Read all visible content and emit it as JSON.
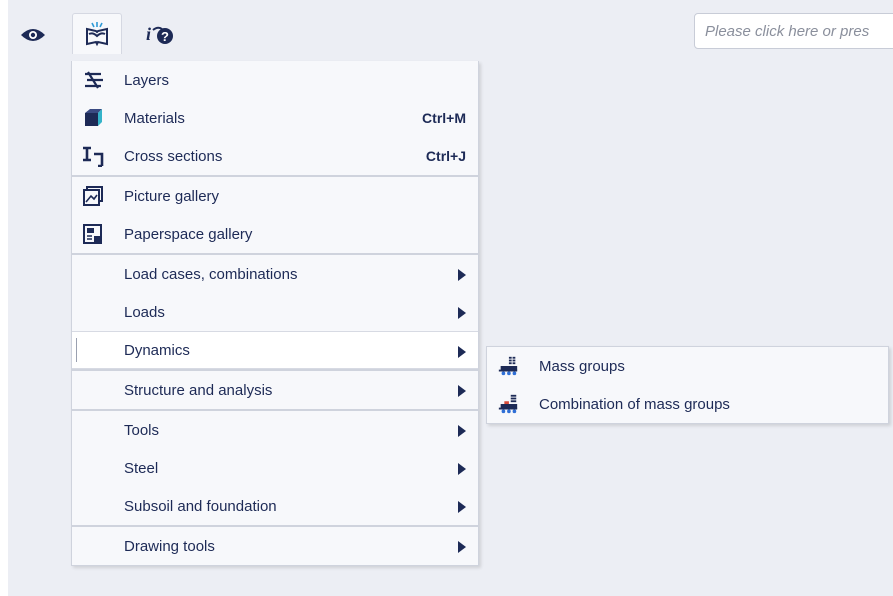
{
  "toolbar": {
    "icons": [
      "eye-icon",
      "library-book-icon",
      "help-search-icon"
    ],
    "search_placeholder": "Please click here or pres"
  },
  "menu": {
    "groups": [
      {
        "items": [
          {
            "label": "Layers",
            "icon": "layers-icon",
            "shortcut": ""
          },
          {
            "label": "Materials",
            "icon": "materials-cube-icon",
            "shortcut": "Ctrl+M"
          },
          {
            "label": "Cross sections",
            "icon": "cross-section-icon",
            "shortcut": "Ctrl+J"
          }
        ]
      },
      {
        "items": [
          {
            "label": "Picture gallery",
            "icon": "picture-gallery-icon"
          },
          {
            "label": "Paperspace gallery",
            "icon": "paperspace-gallery-icon"
          }
        ]
      },
      {
        "items": [
          {
            "label": "Load cases, combinations",
            "submenu": true
          },
          {
            "label": "Loads",
            "submenu": true
          },
          {
            "label": "Dynamics",
            "submenu": true,
            "active": true
          }
        ]
      },
      {
        "items": [
          {
            "label": "Structure and analysis",
            "submenu": true
          }
        ]
      },
      {
        "items": [
          {
            "label": "Tools",
            "submenu": true
          },
          {
            "label": "Steel",
            "submenu": true
          },
          {
            "label": "Subsoil and foundation",
            "submenu": true
          }
        ]
      },
      {
        "items": [
          {
            "label": "Drawing tools",
            "submenu": true
          }
        ]
      }
    ]
  },
  "submenu": {
    "parent": "Dynamics",
    "items": [
      {
        "label": "Mass groups",
        "icon": "mass-groups-icon"
      },
      {
        "label": "Combination of mass groups",
        "icon": "combination-mass-groups-icon"
      }
    ]
  },
  "colors": {
    "text": "#1d2a56",
    "accent": "#2f6fd6",
    "menu_bg": "#f7f8fb",
    "page_bg": "#eceef4"
  }
}
